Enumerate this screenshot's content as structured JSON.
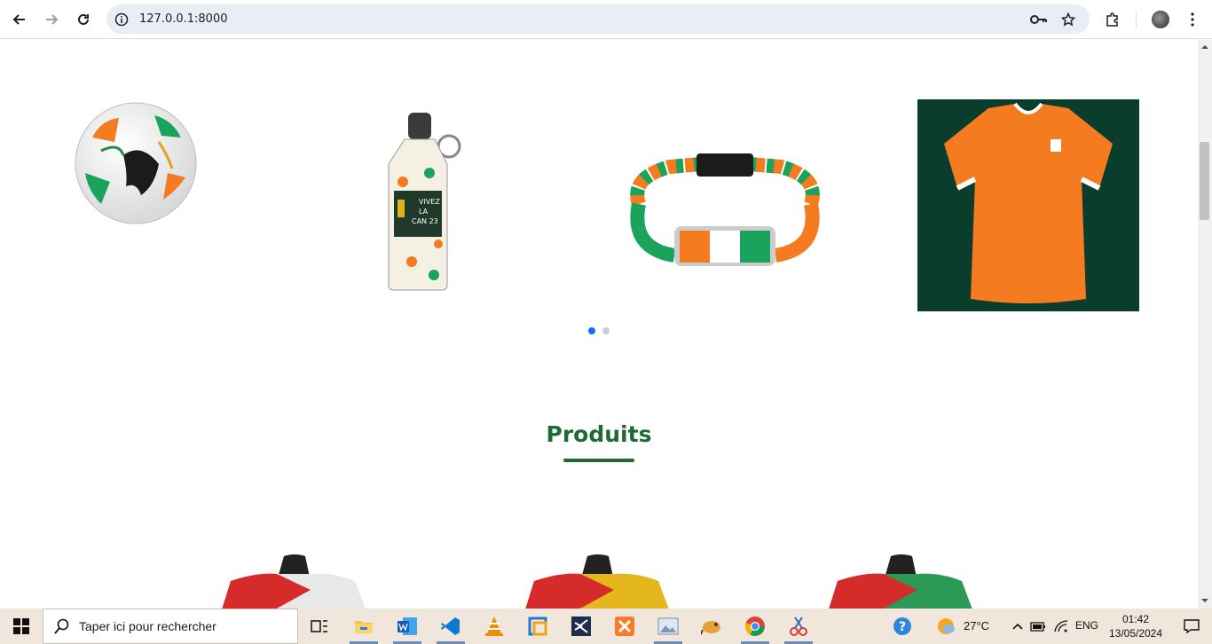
{
  "browser": {
    "url": "127.0.0.1:8000",
    "back_icon": "arrow-left-icon",
    "forward_icon": "arrow-right-icon",
    "reload_icon": "reload-icon",
    "site_info_icon": "info-icon",
    "password_icon": "key-icon",
    "bookmark_icon": "star-icon",
    "extensions_icon": "puzzle-icon",
    "menu_icon": "kebab-icon"
  },
  "carousel": {
    "slides": [
      {
        "name": "ball",
        "icon": "football-image"
      },
      {
        "name": "bottle",
        "icon": "water-bottle-image",
        "label_lines": [
          "VIVEZ",
          "LA",
          "CAN 23"
        ]
      },
      {
        "name": "bracelet",
        "icon": "flag-bracelet-image"
      },
      {
        "name": "jersey",
        "icon": "orange-jersey-image"
      }
    ],
    "active_dot": 0,
    "dot_count": 2
  },
  "section": {
    "title": "Produits"
  },
  "colors": {
    "accent_green": "#1e6b31",
    "dot_active": "#0d6efd",
    "orange": "#f47b20",
    "green": "#1aa35a"
  },
  "taskbar": {
    "search_placeholder": "Taper ici pour rechercher",
    "apps": [
      "task-view",
      "file-explorer",
      "word",
      "vscode",
      "vlc",
      "virtualbox",
      "visual-studio",
      "xampp",
      "image-viewer",
      "dbeaver",
      "chrome",
      "snipping-tool"
    ],
    "weather": "27°C",
    "language": "ENG",
    "time": "01:42",
    "date": "13/05/2024"
  }
}
